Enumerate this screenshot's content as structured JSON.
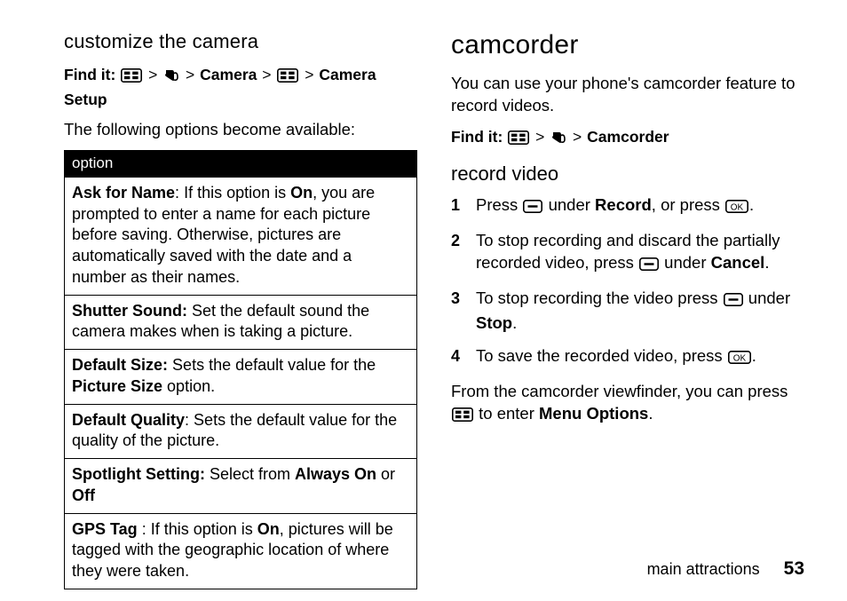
{
  "left": {
    "heading": "customize the camera",
    "findit_label": "Find it:",
    "findit_parts": [
      "Camera",
      "Camera Setup"
    ],
    "intro": "The following options become available:",
    "table_header": "option",
    "rows": [
      {
        "label": "Ask for Name",
        "sep": ": ",
        "text_a": "If this option is ",
        "bold_a": "On",
        "text_b": ", you are prompted to enter a name for each picture before saving. Otherwise, pictures are automatically saved with the date and a number as their names."
      },
      {
        "label": "Shutter Sound:",
        "sep": " ",
        "text_a": "Set the default sound the camera makes when is taking a picture.",
        "bold_a": "",
        "text_b": ""
      },
      {
        "label": "Default Size:",
        "sep": " ",
        "text_a": "Sets the default value for the ",
        "bold_a": "Picture Size",
        "text_b": " option."
      },
      {
        "label": "Default Quality",
        "sep": ": ",
        "text_a": "Sets the default value for the quality of the picture.",
        "bold_a": "",
        "text_b": ""
      },
      {
        "label": "Spotlight Setting:",
        "sep": " ",
        "text_a": "Select from ",
        "bold_a": "Always On",
        "text_b": " or ",
        "bold_b": "Off"
      },
      {
        "label": "GPS Tag",
        "sep": " : ",
        "text_a": "If this option is ",
        "bold_a": "On",
        "text_b": ", pictures will be tagged with the geographic location of where they were taken."
      }
    ]
  },
  "right": {
    "heading": "camcorder",
    "intro": "You can use your phone's camcorder feature to record videos.",
    "findit_label": "Find it:",
    "findit_target": "Camcorder",
    "sub": "record video",
    "steps": [
      {
        "pre": "Press ",
        "mid": " under ",
        "bold": "Record",
        "post": ", or press ",
        "tail": "."
      },
      {
        "pre": "To stop recording and discard the partially recorded video, press ",
        "mid": " under ",
        "bold": "Cancel",
        "post": "",
        "tail": "."
      },
      {
        "pre": "To stop recording the video press ",
        "mid": " under ",
        "bold": "Stop",
        "post": "",
        "tail": "."
      },
      {
        "pre": "To save the recorded video, press ",
        "mid": "",
        "bold": "",
        "post": "",
        "tail": "."
      }
    ],
    "outro_a": "From the camcorder viewfinder, you can press ",
    "outro_b": " to enter ",
    "outro_bold": "Menu Options",
    "outro_c": "."
  },
  "footer": {
    "section": "main attractions",
    "page": "53"
  }
}
